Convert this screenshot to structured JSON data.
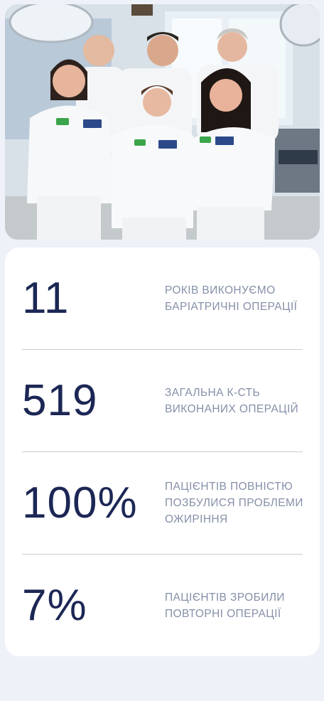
{
  "stats": [
    {
      "value": "11",
      "label": "Років виконуємо баріатричні операції"
    },
    {
      "value": "519",
      "label": "Загальна к-сть виконаних операцій"
    },
    {
      "value": "100%",
      "label": "Пацієнтів повністю позбулися проблеми ожиріння"
    },
    {
      "value": "7%",
      "label": "Пацієнтів зробили повторні операції"
    }
  ],
  "colors": {
    "number": "#1c2755",
    "label": "#8590a8",
    "card": "#ffffff",
    "background": "#eef1f7"
  }
}
